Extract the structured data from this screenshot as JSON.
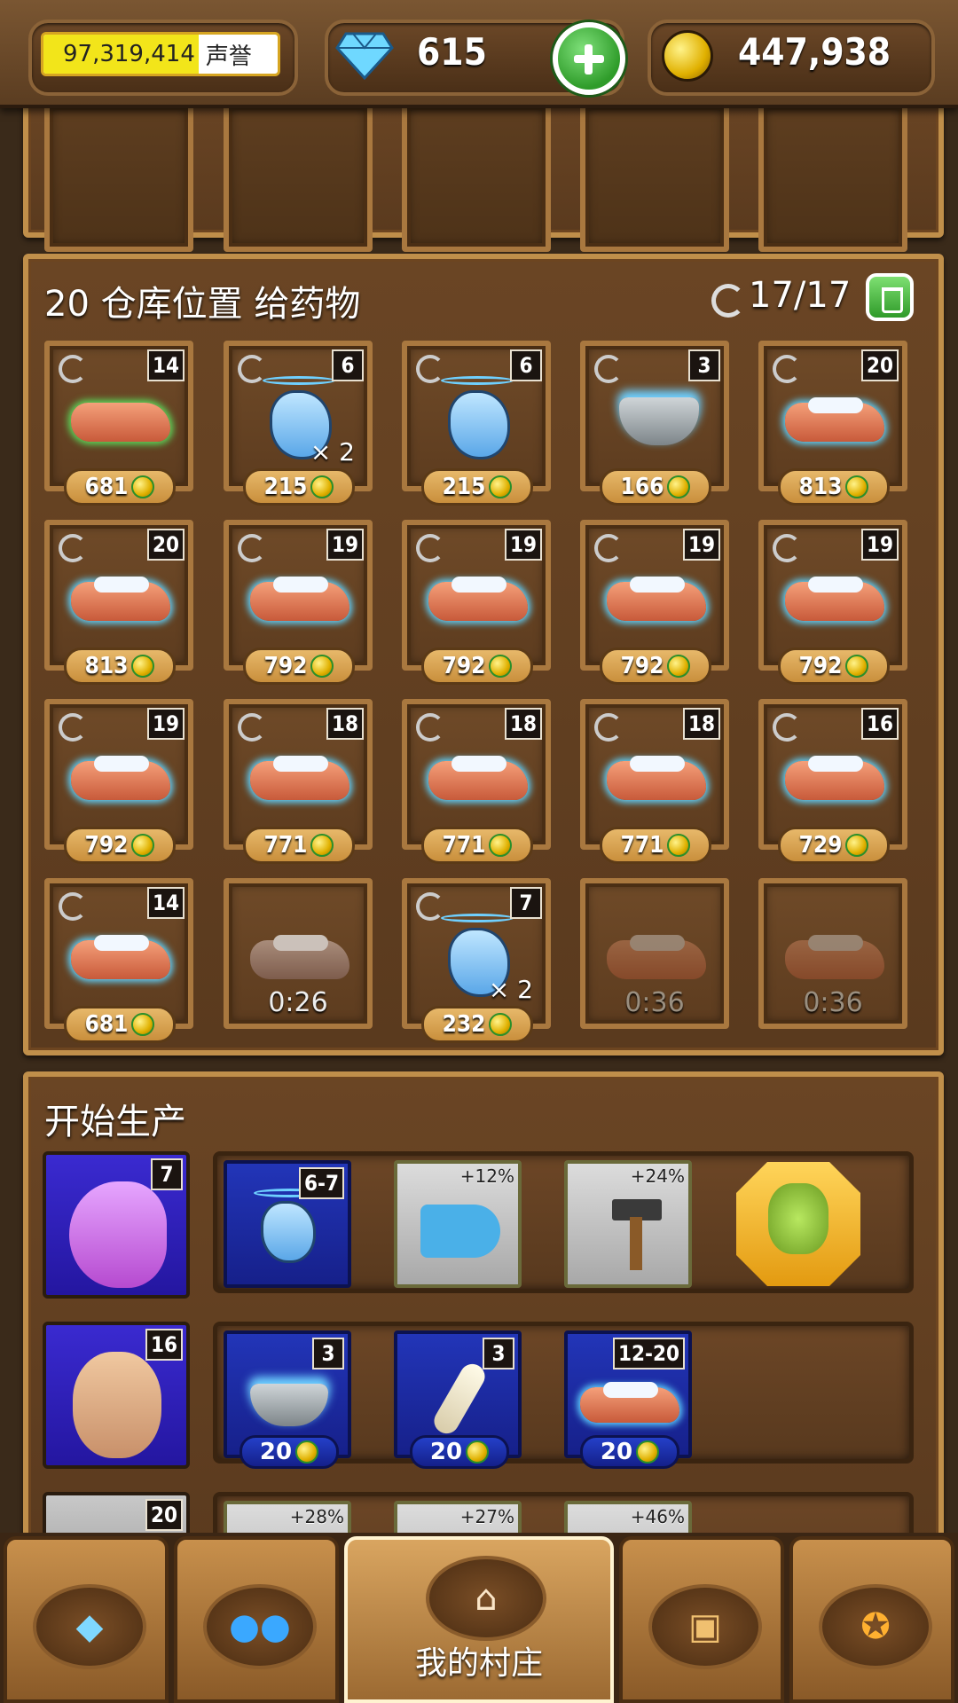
{
  "topbar": {
    "reputation_value": "97,319,414",
    "reputation_label": "声誉",
    "gems": "615",
    "coins": "447,938"
  },
  "storage": {
    "title": "20 仓库位置 给药物",
    "capacity": "17/17",
    "items": [
      {
        "count": "14",
        "price": "681",
        "kind": "arm-green"
      },
      {
        "count": "6",
        "price": "215",
        "kind": "unicorn",
        "multiplier": "× 2"
      },
      {
        "count": "6",
        "price": "215",
        "kind": "unicorn"
      },
      {
        "count": "3",
        "price": "166",
        "kind": "mortar"
      },
      {
        "count": "20",
        "price": "813",
        "kind": "arm"
      },
      {
        "count": "20",
        "price": "813",
        "kind": "arm"
      },
      {
        "count": "19",
        "price": "792",
        "kind": "arm"
      },
      {
        "count": "19",
        "price": "792",
        "kind": "arm"
      },
      {
        "count": "19",
        "price": "792",
        "kind": "arm"
      },
      {
        "count": "19",
        "price": "792",
        "kind": "arm"
      },
      {
        "count": "19",
        "price": "792",
        "kind": "arm"
      },
      {
        "count": "18",
        "price": "771",
        "kind": "arm"
      },
      {
        "count": "18",
        "price": "771",
        "kind": "arm"
      },
      {
        "count": "18",
        "price": "771",
        "kind": "arm"
      },
      {
        "count": "16",
        "price": "729",
        "kind": "arm"
      },
      {
        "count": "14",
        "price": "681",
        "kind": "arm"
      },
      {
        "timer": "0:26",
        "kind": "arm-gray"
      },
      {
        "count": "7",
        "price": "232",
        "kind": "unicorn",
        "multiplier": "× 2"
      },
      {
        "timer": "0:36",
        "kind": "arm-faded"
      },
      {
        "timer": "0:36",
        "kind": "arm-faded"
      }
    ]
  },
  "production": {
    "title": "开始生产",
    "rows": [
      {
        "level": "7",
        "cards": [
          {
            "badge": "6-7"
          },
          {
            "pct": "+12%"
          },
          {
            "pct": "+24%"
          }
        ]
      },
      {
        "level": "16",
        "cards": [
          {
            "badge": "3",
            "cost": "20"
          },
          {
            "badge": "3",
            "cost": "20"
          },
          {
            "badge": "12-20",
            "cost": "20"
          }
        ]
      },
      {
        "level": "20",
        "cards": [
          {
            "pct": "+28%"
          },
          {
            "pct": "+27%"
          },
          {
            "pct": "+46%"
          }
        ]
      }
    ]
  },
  "nav": {
    "village_label": "我的村庄"
  }
}
